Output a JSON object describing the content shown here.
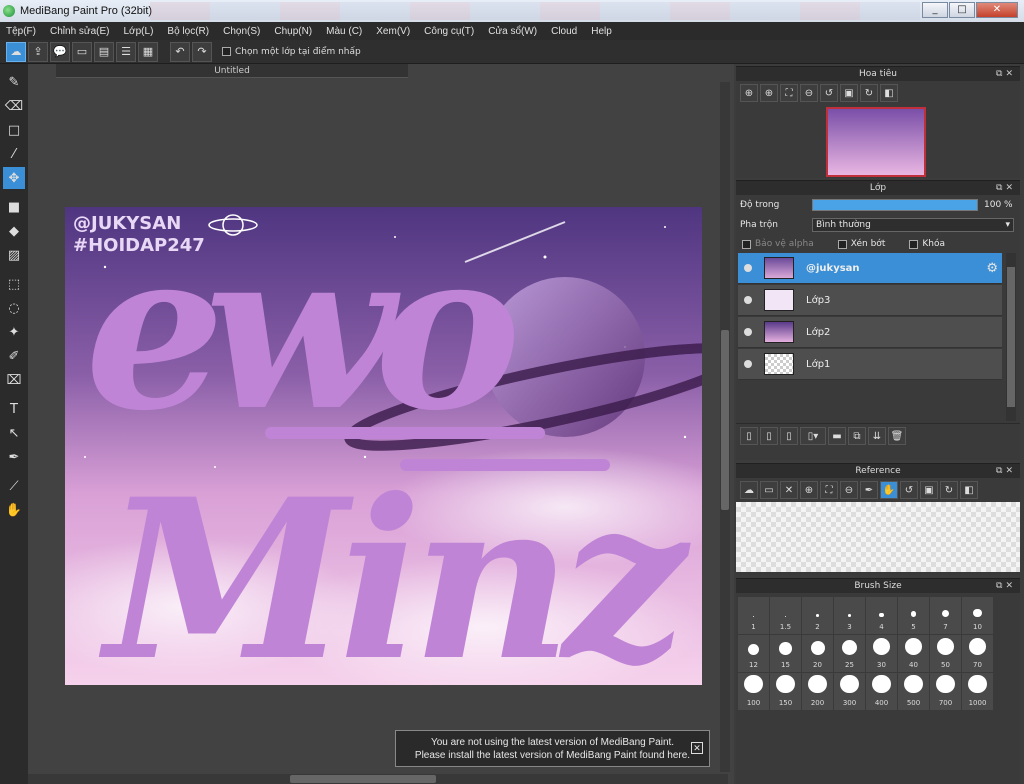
{
  "window": {
    "title": "MediBang Paint Pro (32bit)",
    "min": "_",
    "max": "□",
    "close": "✕"
  },
  "menu": [
    "Tệp(F)",
    "Chỉnh sửa(E)",
    "Lớp(L)",
    "Bộ lọc(R)",
    "Chọn(S)",
    "Chụp(N)",
    "Màu (C)",
    "Xem(V)",
    "Công cụ(T)",
    "Cửa sổ(W)",
    "Cloud",
    "Help"
  ],
  "toolbar": {
    "select_layer_label": "Chọn một lớp tại điểm nhấp"
  },
  "document": {
    "tab_title": "Untitled"
  },
  "artwork": {
    "watermark1": "@JUKYSAN",
    "watermark2": "#HOIDAP247",
    "word1": "ewo",
    "word2": "Minz",
    "colors": {
      "sky_top": "#5a3d8a",
      "sky_bottom": "#f2c7e6",
      "letters": "#c084d6"
    }
  },
  "notice": {
    "line1": "You are not using the latest version of MediBang Paint.",
    "line2": "Please install the latest version of MediBang Paint found here."
  },
  "navigator": {
    "title": "Hoa tiêu"
  },
  "layers_panel": {
    "title": "Lớp",
    "opacity_label": "Độ trong",
    "opacity_value": "100 %",
    "opacity_fraction": 1.0,
    "blend_label": "Pha trộn",
    "blend_value": "Bình thường",
    "protect_alpha": "Bảo vệ alpha",
    "clipping": "Xén bớt",
    "lock": "Khóa",
    "layers": [
      {
        "name": "@jukysan",
        "selected": true
      },
      {
        "name": "Lớp3",
        "selected": false
      },
      {
        "name": "Lớp2",
        "selected": false
      },
      {
        "name": "Lớp1",
        "selected": false
      }
    ]
  },
  "reference": {
    "title": "Reference"
  },
  "brush_size": {
    "title": "Brush Size",
    "sizes": [
      "1",
      "1.5",
      "2",
      "3",
      "4",
      "5",
      "7",
      "10",
      "12",
      "15",
      "20",
      "25",
      "30",
      "40",
      "50",
      "70",
      "100",
      "150",
      "200",
      "300",
      "400",
      "500",
      "700",
      "1000"
    ]
  },
  "accent_color": "#3a8fd6"
}
